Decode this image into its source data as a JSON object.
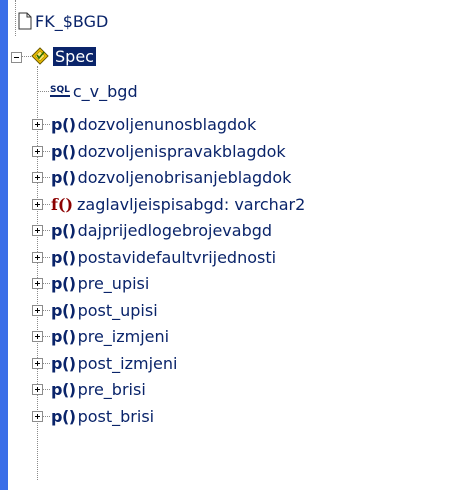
{
  "tree": {
    "root": {
      "label": "FK_$BGD",
      "icon": "document-icon"
    },
    "spec": {
      "label": "Spec",
      "icon": "package-spec-icon",
      "selected": true
    },
    "sql_item": {
      "label": "c_v_bgd",
      "icon_text": "SQL"
    },
    "items": [
      {
        "kind": "p()",
        "label": "dozvoljenunosblagdok"
      },
      {
        "kind": "p()",
        "label": "dozvoljenispravakblagdok"
      },
      {
        "kind": "p()",
        "label": "dozvoljenobrisanjeblagdok"
      },
      {
        "kind": "f()",
        "label": "zaglavljeispisabgd: varchar2"
      },
      {
        "kind": "p()",
        "label": "dajprijedlogebrojevabgd"
      },
      {
        "kind": "p()",
        "label": "postavidefaultvrijednosti"
      },
      {
        "kind": "p()",
        "label": "pre_upisi"
      },
      {
        "kind": "p()",
        "label": "post_upisi"
      },
      {
        "kind": "p()",
        "label": "pre_izmjeni"
      },
      {
        "kind": "p()",
        "label": "post_izmjeni"
      },
      {
        "kind": "p()",
        "label": "pre_brisi"
      },
      {
        "kind": "p()",
        "label": "post_brisi"
      }
    ]
  }
}
